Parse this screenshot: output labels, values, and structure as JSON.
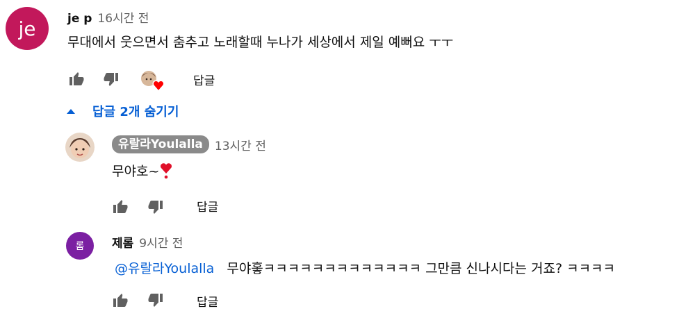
{
  "comment": {
    "avatar_text": "je",
    "avatar_color": "#c2185b",
    "author": "je p",
    "time": "16시간 전",
    "text": "무대에서 웃으면서 춤추고 노래할때 누나가 세상에서 제일 예뻐요 ㅜㅜ",
    "reply_label": "답글",
    "heart_icon": "creator-heart-icon"
  },
  "replies_toggle": {
    "label": "답글 2개 숨기기",
    "icon": "caret-up-icon",
    "color": "#065fd4"
  },
  "replies": [
    {
      "author": "유랄라Youlalla",
      "time": "13시간 전",
      "text": "무야호~",
      "emoji_icon": "heart-exclamation-icon",
      "reply_label": "답글"
    },
    {
      "avatar_text": "롬",
      "avatar_color": "#7b1fa2",
      "author": "제롬",
      "time": "9시간 전",
      "mention": "@유랄라Youlalla",
      "text": "무야홓ㅋㅋㅋㅋㅋㅋㅋㅋㅋㅋㅋㅋㅋ 그만큼 신나시다는 거죠? ㅋㅋㅋㅋ",
      "reply_label": "답글"
    }
  ]
}
